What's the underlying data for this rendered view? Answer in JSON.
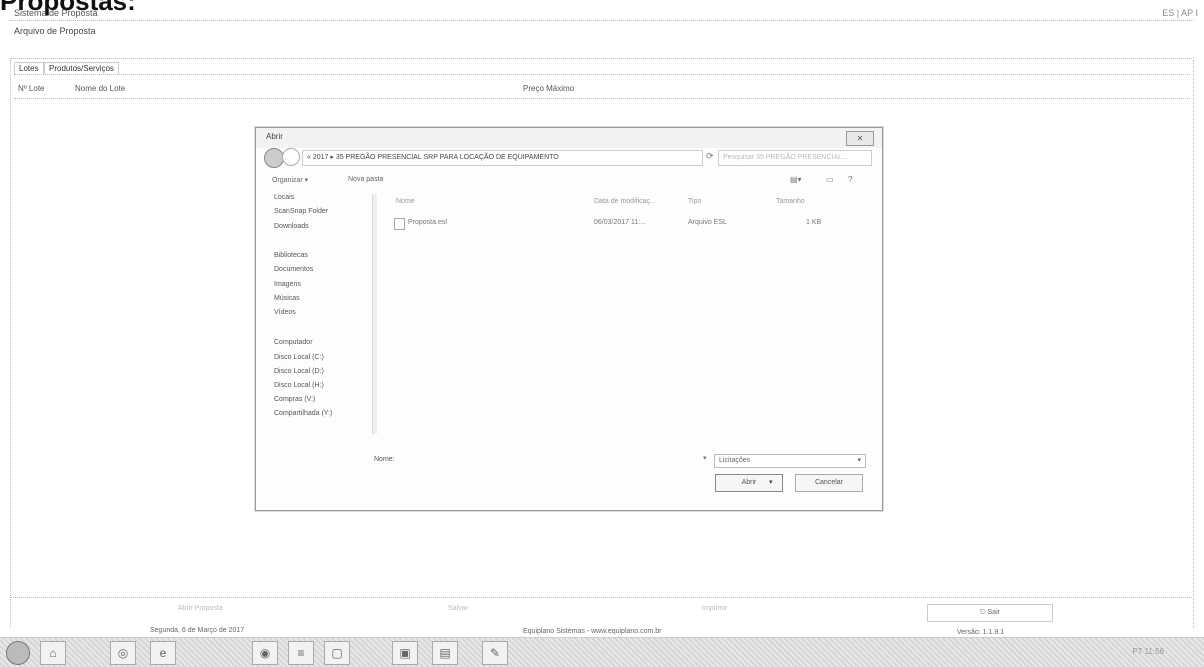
{
  "document_heading": "Propostas:",
  "app": {
    "title": "Sistema de Proposta",
    "menu_item": "Arquivo de Proposta",
    "title_right": "ES | AP I"
  },
  "tabs": [
    "Lotes",
    "Produtos/Serviços"
  ],
  "columns": {
    "lot_number": "Nº Lote",
    "lot_name": "Nome do Lote",
    "max_price": "Preço Máximo"
  },
  "dialog": {
    "title": "Abrir",
    "close_label": "✕",
    "address": "« 2017 ▸ 35 PREGÃO PRESENCIAL SRP PARA LOCAÇÃO DE EQUIPAMENTO",
    "search_placeholder": "Pesquisar 35 PREGÃO PRESENCIAL...",
    "toolbar": {
      "organize": "Organizar ▾",
      "new_folder": "Nova pasta"
    },
    "tree": [
      "Locais",
      "ScanSnap Folder",
      "Downloads",
      "Bibliotecas",
      "Documentos",
      "Imagens",
      "Músicas",
      "Vídeos",
      "Computador",
      "Disco Local (C:)",
      "Disco Local (D:)",
      "Disco Local (H:)",
      "Compras (V:)",
      "Compartilhada (Y:)"
    ],
    "file_columns": [
      "Nome",
      "Data de modificaç...",
      "Tipo",
      "Tamanho"
    ],
    "files": [
      {
        "name": "Proposta.esl",
        "modified": "06/03/2017 11:...",
        "type": "Arquivo ESL",
        "size": "1 KB"
      }
    ],
    "name_label": "Nome:",
    "filter_value": "Licitações",
    "open_button": "Abrir",
    "cancel_button": "Cancelar"
  },
  "bottom_buttons": [
    "Abrir Proposta",
    "Salvar",
    "Imprimir"
  ],
  "exit_button": "Sair",
  "status": {
    "date": "Segunda, 6 de Março de 2017",
    "company": "Equiplano Sistemas - www.equiplano.com.br",
    "version": "Versão: 1.1.9.1"
  },
  "taskbar": {
    "tray_text": "PT 11:56"
  }
}
